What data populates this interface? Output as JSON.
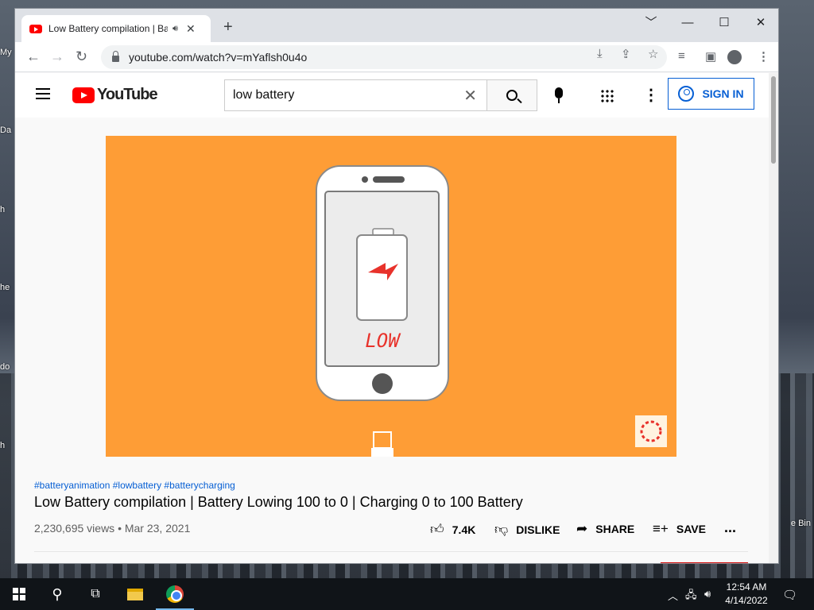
{
  "desktop": {
    "labels_left": [
      "My",
      "Da",
      "h",
      "he",
      "do",
      "h"
    ],
    "label_right": "e Bin"
  },
  "browser": {
    "tab_title": "Low Battery compilation | Ba",
    "audio_icon": "speaker-icon",
    "url": "youtube.com/watch?v=mYaflsh0u4o",
    "window_controls": [
      "﹀",
      "—",
      "☐",
      "✕"
    ]
  },
  "youtube": {
    "logo_text": "YouTube",
    "search_value": "low battery",
    "signin_label": "SIGN IN",
    "video": {
      "screen_text": "LOW",
      "tags": "#batteryanimation #lowbattery #batterycharging",
      "title": "Low Battery compilation | Battery Lowing 100 to 0 | Charging 0 to 100 Battery",
      "views_date": "2,230,695 views • Mar 23, 2021",
      "likes": "7.4K",
      "dislike_label": "DISLIKE",
      "share_label": "SHARE",
      "save_label": "SAVE",
      "more_label": "..."
    }
  },
  "taskbar": {
    "time": "12:54 AM",
    "date": "4/14/2022"
  },
  "colors": {
    "video_bg": "#fe9d36",
    "youtube_red": "#ff0000",
    "link_blue": "#065fd4",
    "bolt_red": "#e8322b"
  }
}
